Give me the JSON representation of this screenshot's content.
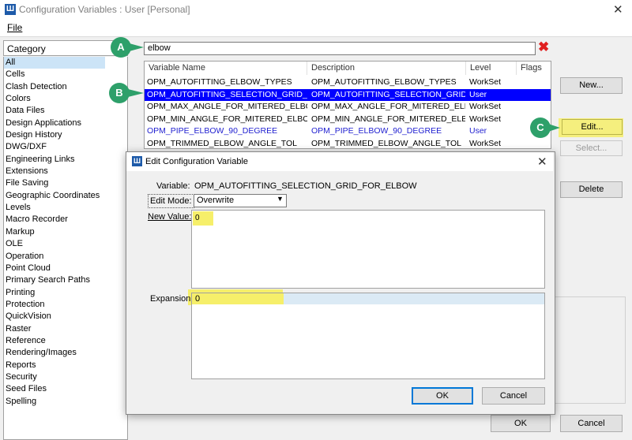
{
  "window": {
    "title": "Configuration Variables : User [Personal]",
    "close_glyph": "✕"
  },
  "menu": {
    "file_label": "File"
  },
  "category": {
    "header": "Category",
    "items": [
      "All",
      "Cells",
      "Clash Detection",
      "Colors",
      "Data Files",
      "Design Applications",
      "Design History",
      "DWG/DXF",
      "Engineering Links",
      "Extensions",
      "File Saving",
      "Geographic Coordinates",
      "Levels",
      "Macro Recorder",
      "Markup",
      "OLE",
      "Operation",
      "Point Cloud",
      "Primary Search Paths",
      "Printing",
      "Protection",
      "QuickVision",
      "Raster",
      "Reference",
      "Rendering/Images",
      "Reports",
      "Security",
      "Seed Files",
      "Spelling"
    ]
  },
  "search": {
    "value": "elbow",
    "clear_glyph": "✖"
  },
  "table": {
    "headers": [
      "Variable Name",
      "Description",
      "Level",
      "Flags"
    ],
    "rows": [
      {
        "name": "OPM_AUTOFITTING_ELBOW_TYPES",
        "description": "OPM_AUTOFITTING_ELBOW_TYPES",
        "level": "WorkSet"
      },
      {
        "name": "OPM_AUTOFITTING_SELECTION_GRID_FOR_...",
        "description": "OPM_AUTOFITTING_SELECTION_GRID_FOR...",
        "level": "User"
      },
      {
        "name": "OPM_MAX_ANGLE_FOR_MITERED_ELBOWS",
        "description": "OPM_MAX_ANGLE_FOR_MITERED_ELBOWS",
        "level": "WorkSet"
      },
      {
        "name": "OPM_MIN_ANGLE_FOR_MITERED_ELBOWS",
        "description": "OPM_MIN_ANGLE_FOR_MITERED_ELBOWS",
        "level": "WorkSet"
      },
      {
        "name": "OPM_PIPE_ELBOW_90_DEGREE",
        "description": "OPM_PIPE_ELBOW_90_DEGREE",
        "level": "User"
      },
      {
        "name": "OPM_TRIMMED_ELBOW_ANGLE_TOL",
        "description": "OPM_TRIMMED_ELBOW_ANGLE_TOL",
        "level": "WorkSet"
      }
    ]
  },
  "buttons": {
    "new": "New...",
    "edit": "Edit...",
    "select": "Select...",
    "delete": "Delete",
    "ok": "OK",
    "cancel": "Cancel"
  },
  "callouts": {
    "a": "A",
    "b": "B",
    "c": "C"
  },
  "dialog": {
    "title": "Edit Configuration Variable",
    "close_glyph": "✕",
    "variable_label": "Variable:",
    "variable_value": "OPM_AUTOFITTING_SELECTION_GRID_FOR_ELBOW",
    "edit_mode_label": "Edit Mode:",
    "edit_mode_value": "Overwrite",
    "new_value_label": "New Value:",
    "new_value": "0",
    "expansion_label": "Expansion:",
    "expansion_value": "0",
    "ok": "OK",
    "cancel": "Cancel"
  },
  "colors": {
    "selection": "#0000ff",
    "user_level_text": "#1f1fd0",
    "highlight": "#f6ef6a",
    "callout": "#2ea06a",
    "clear_icon": "#e02020"
  },
  "icons": [
    "app-icon",
    "close-icon",
    "clear-search-icon",
    "dropdown-arrow-icon"
  ]
}
